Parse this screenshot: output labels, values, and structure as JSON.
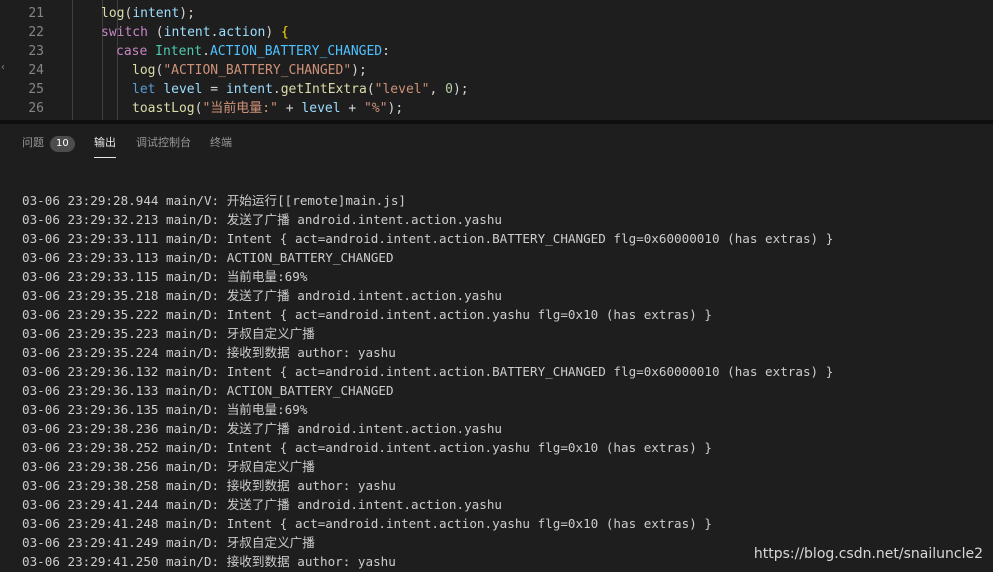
{
  "editor": {
    "lines": [
      {
        "num": "21",
        "tokens": [
          {
            "t": "log",
            "c": "fn"
          },
          {
            "t": "(",
            "c": ""
          },
          {
            "t": "intent",
            "c": "var"
          },
          {
            "t": ");",
            "c": ""
          }
        ],
        "indent": 0
      },
      {
        "num": "22",
        "tokens": [
          {
            "t": "switch",
            "c": "kw"
          },
          {
            "t": " (",
            "c": ""
          },
          {
            "t": "intent",
            "c": "var"
          },
          {
            "t": ".",
            "c": ""
          },
          {
            "t": "action",
            "c": "var"
          },
          {
            "t": ") ",
            "c": ""
          },
          {
            "t": "{",
            "c": "brace"
          }
        ],
        "indent": 0
      },
      {
        "num": "23",
        "tokens": [
          {
            "t": "case ",
            "c": "kw"
          },
          {
            "t": "Intent",
            "c": "cls"
          },
          {
            "t": ".",
            "c": ""
          },
          {
            "t": "ACTION_BATTERY_CHANGED",
            "c": "const"
          },
          {
            "t": ":",
            "c": ""
          }
        ],
        "indent": 1
      },
      {
        "num": "24",
        "tokens": [
          {
            "t": "log",
            "c": "fn"
          },
          {
            "t": "(",
            "c": ""
          },
          {
            "t": "\"ACTION_BATTERY_CHANGED\"",
            "c": "str"
          },
          {
            "t": ");",
            "c": ""
          }
        ],
        "indent": 2
      },
      {
        "num": "25",
        "tokens": [
          {
            "t": "let ",
            "c": "kw2"
          },
          {
            "t": "level",
            "c": "var"
          },
          {
            "t": " = ",
            "c": ""
          },
          {
            "t": "intent",
            "c": "var"
          },
          {
            "t": ".",
            "c": ""
          },
          {
            "t": "getIntExtra",
            "c": "fn"
          },
          {
            "t": "(",
            "c": ""
          },
          {
            "t": "\"level\"",
            "c": "str"
          },
          {
            "t": ", ",
            "c": ""
          },
          {
            "t": "0",
            "c": "num"
          },
          {
            "t": ");",
            "c": ""
          }
        ],
        "indent": 2
      },
      {
        "num": "26",
        "tokens": [
          {
            "t": "toastLog",
            "c": "fn"
          },
          {
            "t": "(",
            "c": ""
          },
          {
            "t": "\"当前电量:\"",
            "c": "str"
          },
          {
            "t": " + ",
            "c": ""
          },
          {
            "t": "level",
            "c": "var"
          },
          {
            "t": " + ",
            "c": ""
          },
          {
            "t": "\"%\"",
            "c": "str"
          },
          {
            "t": ");",
            "c": ""
          }
        ],
        "indent": 2
      }
    ]
  },
  "panel": {
    "tabs": [
      {
        "label": "问题",
        "badge": "10"
      },
      {
        "label": "输出",
        "active": true
      },
      {
        "label": "调试控制台"
      },
      {
        "label": "终端"
      }
    ]
  },
  "output": {
    "lines": [
      "03-06 23:29:28.944 main/V: 开始运行[[remote]main.js]",
      "03-06 23:29:32.213 main/D: 发送了广播 android.intent.action.yashu",
      "03-06 23:29:33.111 main/D: Intent { act=android.intent.action.BATTERY_CHANGED flg=0x60000010 (has extras) }",
      "03-06 23:29:33.113 main/D: ACTION_BATTERY_CHANGED",
      "03-06 23:29:33.115 main/D: 当前电量:69%",
      "03-06 23:29:35.218 main/D: 发送了广播 android.intent.action.yashu",
      "03-06 23:29:35.222 main/D: Intent { act=android.intent.action.yashu flg=0x10 (has extras) }",
      "03-06 23:29:35.223 main/D: 牙叔自定义广播",
      "03-06 23:29:35.224 main/D: 接收到数据 author: yashu",
      "03-06 23:29:36.132 main/D: Intent { act=android.intent.action.BATTERY_CHANGED flg=0x60000010 (has extras) }",
      "03-06 23:29:36.133 main/D: ACTION_BATTERY_CHANGED",
      "03-06 23:29:36.135 main/D: 当前电量:69%",
      "03-06 23:29:38.236 main/D: 发送了广播 android.intent.action.yashu",
      "03-06 23:29:38.252 main/D: Intent { act=android.intent.action.yashu flg=0x10 (has extras) }",
      "03-06 23:29:38.256 main/D: 牙叔自定义广播",
      "03-06 23:29:38.258 main/D: 接收到数据 author: yashu",
      "03-06 23:29:41.244 main/D: 发送了广播 android.intent.action.yashu",
      "03-06 23:29:41.248 main/D: Intent { act=android.intent.action.yashu flg=0x10 (has extras) }",
      "03-06 23:29:41.249 main/D: 牙叔自定义广播",
      "03-06 23:29:41.250 main/D: 接收到数据 author: yashu"
    ]
  },
  "watermark": "https://blog.csdn.net/snailuncle2"
}
